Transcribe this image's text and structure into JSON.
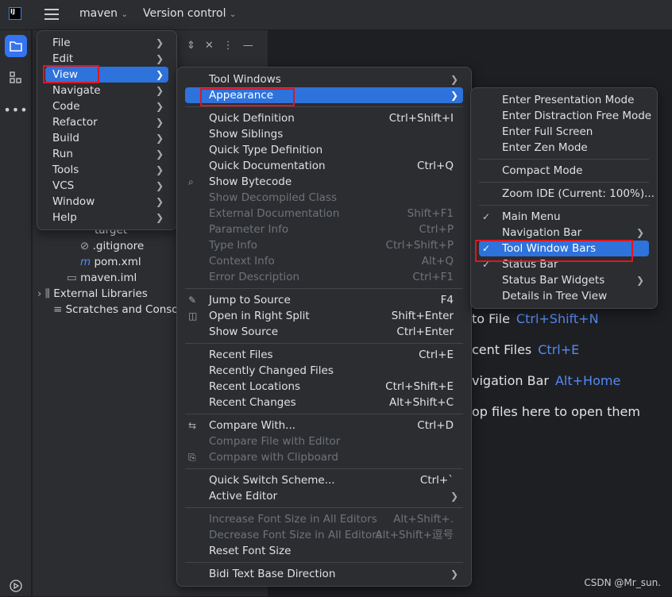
{
  "topbar": {
    "logo": "IJ",
    "project": "maven",
    "vcs": "Version control"
  },
  "tree": {
    "items": [
      "target",
      ".gitignore",
      "pom.xml",
      "maven.iml",
      "External Libraries",
      "Scratches and Consoles"
    ]
  },
  "hints": [
    {
      "text": "to File",
      "key": "Ctrl+Shift+N"
    },
    {
      "text": "cent Files",
      "key": "Ctrl+E"
    },
    {
      "text": "vigation Bar",
      "key": "Alt+Home"
    },
    {
      "text": "op files here to open them",
      "key": ""
    }
  ],
  "main_menu": [
    {
      "label": "File",
      "sub": true
    },
    {
      "label": "Edit",
      "sub": true
    },
    {
      "label": "View",
      "sub": true,
      "selected": true
    },
    {
      "label": "Navigate",
      "sub": true
    },
    {
      "label": "Code",
      "sub": true
    },
    {
      "label": "Refactor",
      "sub": true
    },
    {
      "label": "Build",
      "sub": true
    },
    {
      "label": "Run",
      "sub": true
    },
    {
      "label": "Tools",
      "sub": true
    },
    {
      "label": "VCS",
      "sub": true
    },
    {
      "label": "Window",
      "sub": true
    },
    {
      "label": "Help",
      "sub": true
    }
  ],
  "view_menu": [
    {
      "label": "Tool Windows",
      "sub": true
    },
    {
      "label": "Appearance",
      "sub": true,
      "selected": true
    },
    {
      "sep": true
    },
    {
      "label": "Quick Definition",
      "shortcut": "Ctrl+Shift+I"
    },
    {
      "label": "Show Siblings"
    },
    {
      "label": "Quick Type Definition"
    },
    {
      "label": "Quick Documentation",
      "shortcut": "Ctrl+Q"
    },
    {
      "label": "Show Bytecode",
      "icon": "bytecode-icon"
    },
    {
      "label": "Show Decompiled Class",
      "disabled": true
    },
    {
      "label": "External Documentation",
      "shortcut": "Shift+F1",
      "disabled": true
    },
    {
      "label": "Parameter Info",
      "shortcut": "Ctrl+P",
      "disabled": true
    },
    {
      "label": "Type Info",
      "shortcut": "Ctrl+Shift+P",
      "disabled": true
    },
    {
      "label": "Context Info",
      "shortcut": "Alt+Q",
      "disabled": true
    },
    {
      "label": "Error Description",
      "shortcut": "Ctrl+F1",
      "disabled": true
    },
    {
      "sep": true
    },
    {
      "label": "Jump to Source",
      "shortcut": "F4",
      "icon": "pencil-icon"
    },
    {
      "label": "Open in Right Split",
      "shortcut": "Shift+Enter",
      "icon": "split-icon"
    },
    {
      "label": "Show Source",
      "shortcut": "Ctrl+Enter"
    },
    {
      "sep": true
    },
    {
      "label": "Recent Files",
      "shortcut": "Ctrl+E"
    },
    {
      "label": "Recently Changed Files"
    },
    {
      "label": "Recent Locations",
      "shortcut": "Ctrl+Shift+E"
    },
    {
      "label": "Recent Changes",
      "shortcut": "Alt+Shift+C"
    },
    {
      "sep": true
    },
    {
      "label": "Compare With...",
      "shortcut": "Ctrl+D",
      "icon": "compare-icon"
    },
    {
      "label": "Compare File with Editor",
      "disabled": true
    },
    {
      "label": "Compare with Clipboard",
      "disabled": true,
      "icon": "clipboard-icon"
    },
    {
      "sep": true
    },
    {
      "label": "Quick Switch Scheme...",
      "shortcut": "Ctrl+`"
    },
    {
      "label": "Active Editor",
      "sub": true
    },
    {
      "sep": true
    },
    {
      "label": "Increase Font Size in All Editors",
      "shortcut": "Alt+Shift+.",
      "disabled": true
    },
    {
      "label": "Decrease Font Size in All Editors",
      "shortcut": "Alt+Shift+逗号",
      "disabled": true
    },
    {
      "label": "Reset Font Size"
    },
    {
      "sep": true
    },
    {
      "label": "Bidi Text Base Direction",
      "sub": true
    }
  ],
  "appearance_menu": [
    {
      "label": "Enter Presentation Mode"
    },
    {
      "label": "Enter Distraction Free Mode"
    },
    {
      "label": "Enter Full Screen"
    },
    {
      "label": "Enter Zen Mode"
    },
    {
      "sep": true
    },
    {
      "label": "Compact Mode"
    },
    {
      "sep": true
    },
    {
      "label": "Zoom IDE (Current: 100%)..."
    },
    {
      "sep": true
    },
    {
      "label": "Main Menu",
      "checked": true
    },
    {
      "label": "Navigation Bar",
      "sub": true
    },
    {
      "label": "Tool Window Bars",
      "checked": true,
      "selected": true
    },
    {
      "label": "Status Bar",
      "checked": true
    },
    {
      "label": "Status Bar Widgets",
      "sub": true
    },
    {
      "label": "Details in Tree View"
    }
  ],
  "watermark": "CSDN @Mr_sun.",
  "colors": {
    "accent": "#2e72dc",
    "highlight_box": "#e0161f"
  }
}
